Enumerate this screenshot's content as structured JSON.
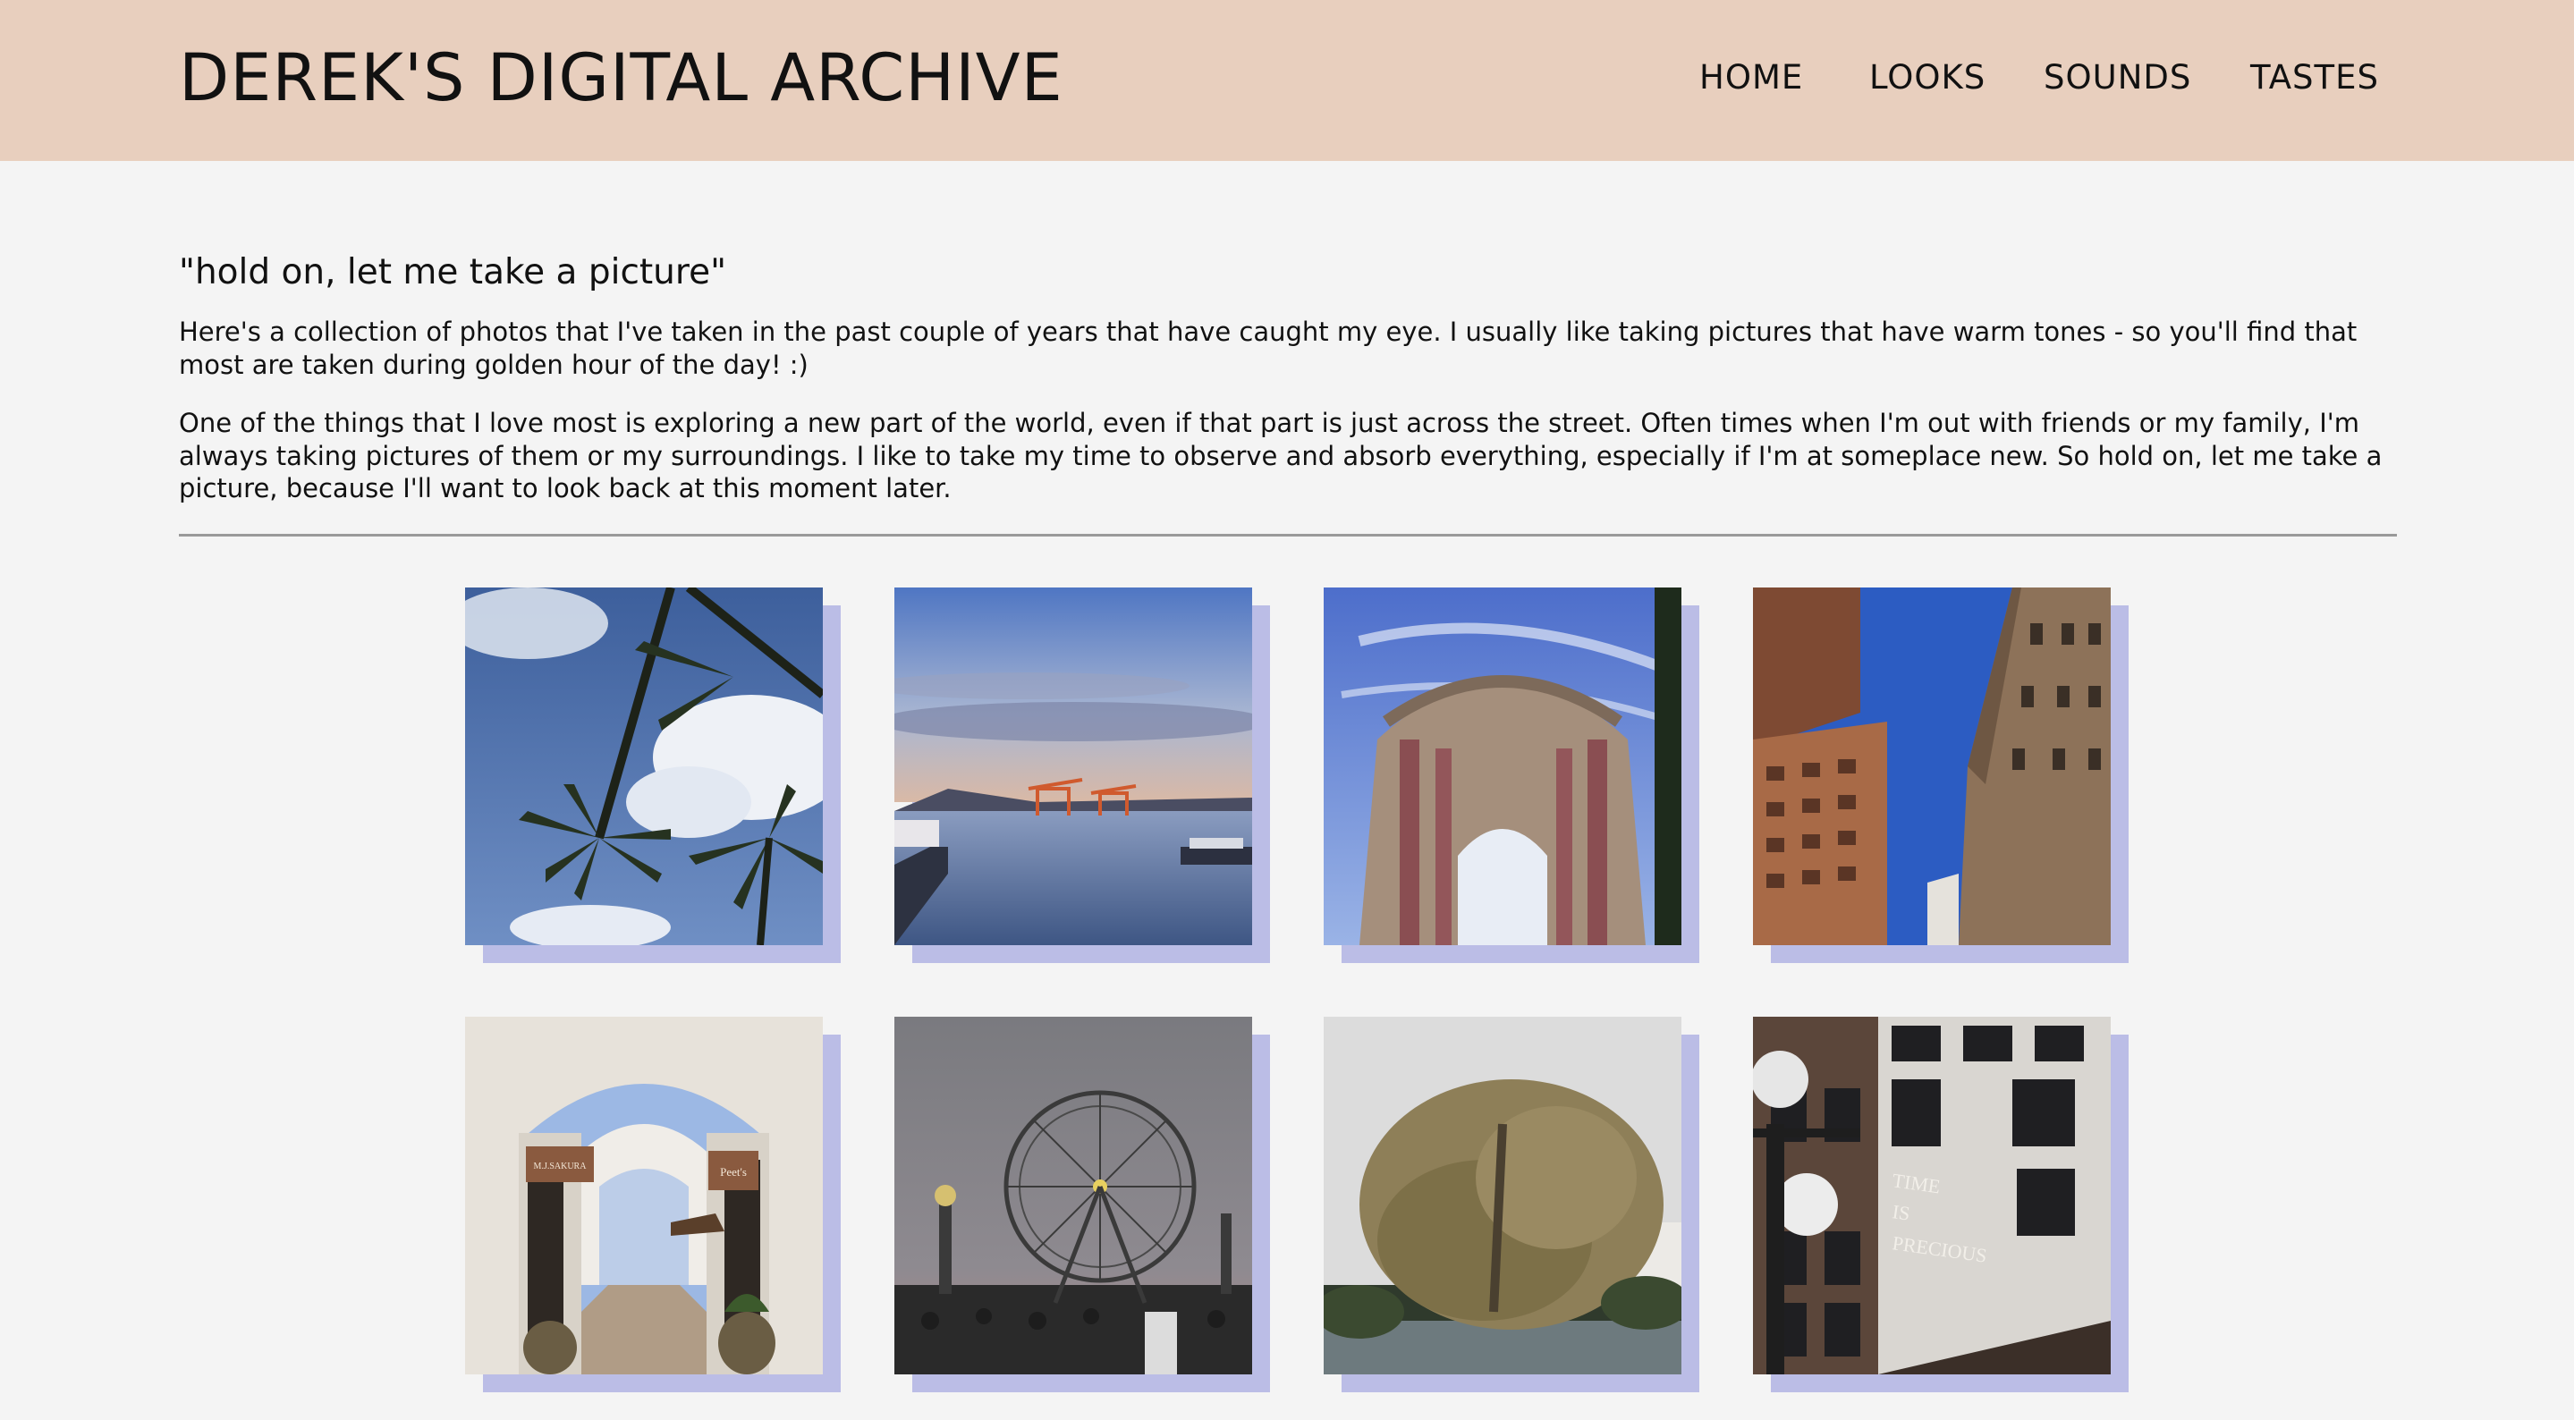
{
  "header": {
    "site_title": "DEREK'S DIGITAL ARCHIVE",
    "nav": [
      "HOME",
      "LOOKS",
      "SOUNDS",
      "TASTES"
    ]
  },
  "intro": {
    "subtitle": "\"hold on, let me take a picture\"",
    "paragraphs": [
      "Here's a collection of photos that I've taken in the past couple of years that have caught my eye. I usually like taking pictures that have warm tones - so you'll find that most are taken during golden hour of the day! :)",
      "One of the things that I love most is exploring a new part of the world, even if that part is just across the street. Often times when I'm out with friends or my family, I'm always taking pictures of them or my surroundings. I like to take my time to observe and absorb everything, especially if I'm at someplace new. So hold on, let me take a picture, because I'll want to look back at this moment later."
    ]
  },
  "gallery": {
    "shadow_color": "#bbbde6",
    "photos": [
      {
        "subject": "palm-trees"
      },
      {
        "subject": "harbor-cranes"
      },
      {
        "subject": "domed-rotunda"
      },
      {
        "subject": "skyscrapers"
      },
      {
        "subject": "arched-shopping-walkway",
        "sign_texts": [
          "M.J.SAKURA",
          "Peet's"
        ]
      },
      {
        "subject": "ferris-wheel-fair"
      },
      {
        "subject": "willow-tree"
      },
      {
        "subject": "brick-building",
        "wall_text": [
          "TIME",
          "IS",
          "PRECIOUS"
        ]
      }
    ]
  },
  "colors": {
    "header_bg": "#e8cfbe",
    "page_bg": "#f4f4f4",
    "divider": "#999999"
  }
}
